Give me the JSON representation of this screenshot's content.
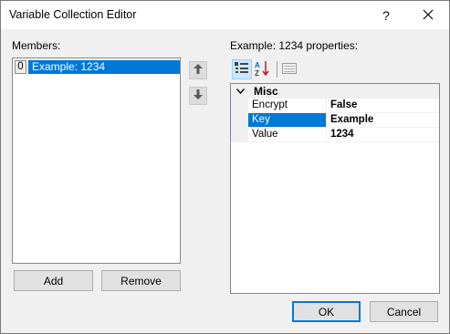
{
  "window": {
    "title": "Variable Collection Editor",
    "help_glyph": "?",
    "close_glyph": "✕"
  },
  "members": {
    "label": "Members:",
    "items": [
      {
        "index": "0",
        "name": "Example: 1234",
        "selected": true
      }
    ],
    "add_label": "Add",
    "remove_label": "Remove"
  },
  "properties": {
    "label": "Example: 1234 properties:",
    "category": "Misc",
    "rows": [
      {
        "name": "Encrypt",
        "value": "False"
      },
      {
        "name": "Key",
        "value": "Example",
        "selected": true
      },
      {
        "name": "Value",
        "value": "1234"
      }
    ]
  },
  "footer": {
    "ok_label": "OK",
    "cancel_label": "Cancel"
  },
  "colors": {
    "selection": "#0078d7",
    "dialog_bg": "#f0f0f0"
  },
  "icons": [
    "help-icon",
    "close-icon",
    "move-up-icon",
    "move-down-icon",
    "categorized-icon",
    "alphabetical-icon",
    "property-pages-icon",
    "collapse-chevron-icon"
  ]
}
